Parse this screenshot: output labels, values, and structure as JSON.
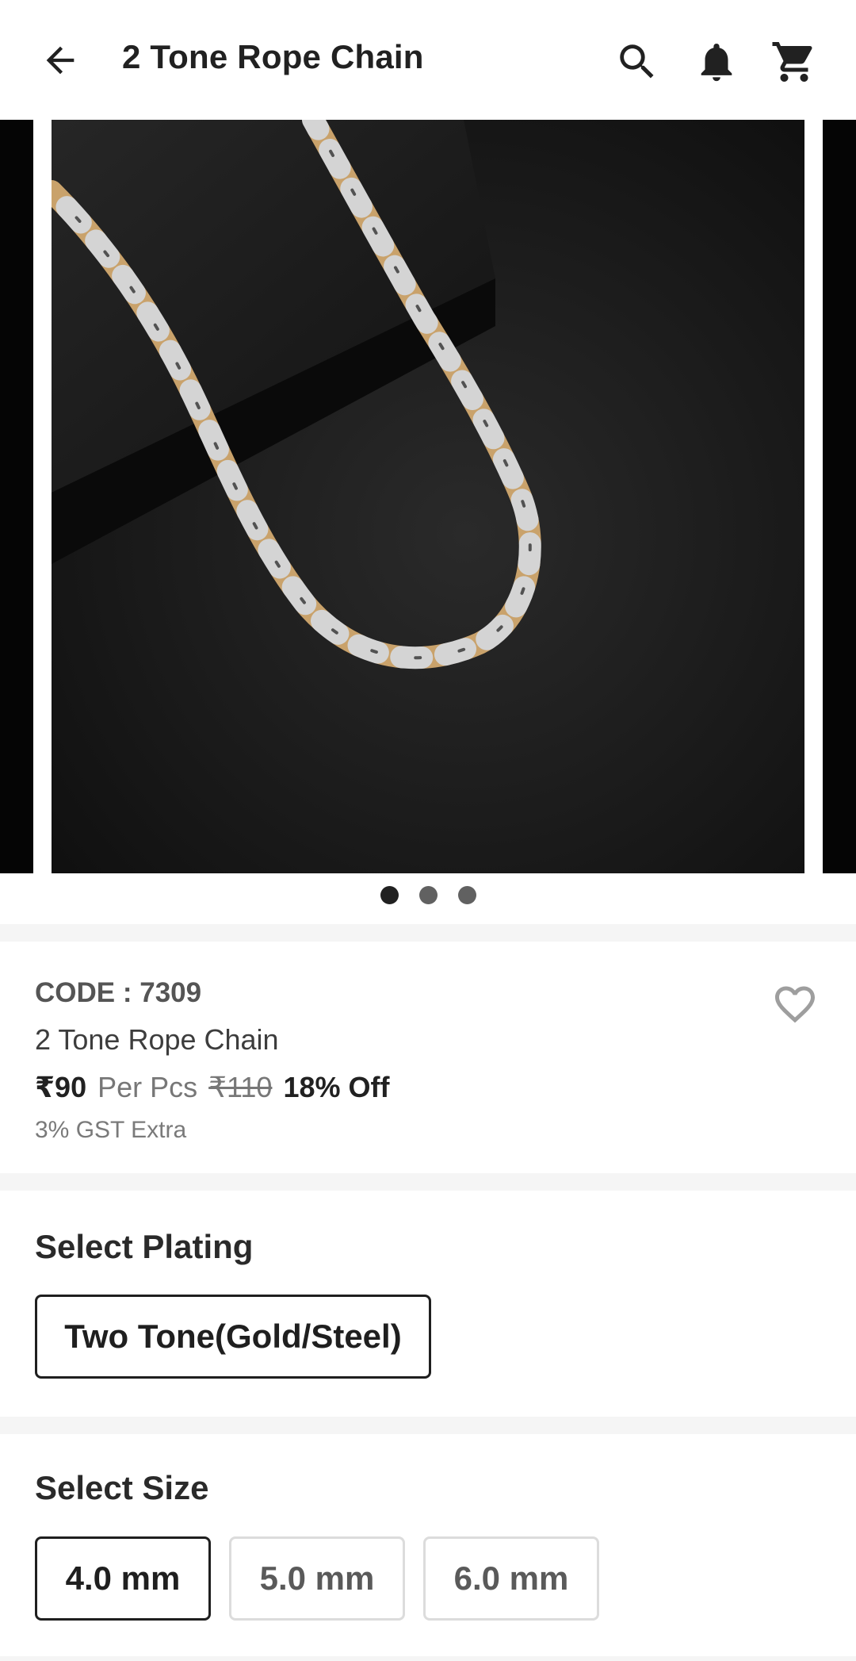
{
  "header": {
    "title": "2 Tone Rope Chain",
    "back_icon": "arrow-back-icon",
    "search_icon": "search-icon",
    "notification_icon": "bell-icon",
    "cart_icon": "cart-icon"
  },
  "carousel": {
    "image_count": 3,
    "active_index": 0
  },
  "product": {
    "code": "CODE : 7309",
    "name": "2 Tone Rope Chain",
    "price": "₹90",
    "unit": "Per Pcs",
    "mrp": "₹110",
    "discount": "18% Off",
    "tax_note": "3% GST Extra"
  },
  "plating": {
    "title": "Select Plating",
    "options": [
      {
        "label": "Two Tone(Gold/Steel)",
        "selected": true
      }
    ]
  },
  "size": {
    "title": "Select Size",
    "options": [
      {
        "label": "4.0 mm",
        "selected": true
      },
      {
        "label": "5.0 mm",
        "selected": false
      },
      {
        "label": "6.0 mm",
        "selected": false
      }
    ]
  },
  "colors": {
    "primary_text": "#212121",
    "muted_text": "#777777",
    "divider": "#f5f5f5",
    "selected_border": "#1f1f1f",
    "unselected_border": "#dcdcdc"
  }
}
